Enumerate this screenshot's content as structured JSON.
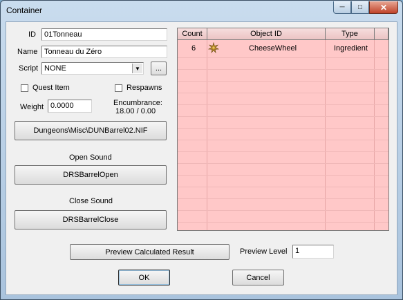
{
  "window": {
    "title": "Container"
  },
  "form": {
    "id_label": "ID",
    "id_value": "01Tonneau",
    "name_label": "Name",
    "name_value": "Tonneau du Zéro",
    "script_label": "Script",
    "script_value": "NONE",
    "browse_label": "...",
    "quest_item_label": "Quest Item",
    "quest_item_checked": false,
    "respawns_label": "Respawns",
    "respawns_checked": false,
    "weight_label": "Weight",
    "weight_value": "0.0000",
    "encumbrance_label": "Encumbrance:",
    "encumbrance_value": "18.00 / 0.00",
    "model_button": "Dungeons\\Misc\\DUNBarrel02.NIF",
    "open_sound_label": "Open Sound",
    "open_sound_button": "DRSBarrelOpen",
    "close_sound_label": "Close Sound",
    "close_sound_button": "DRSBarrelClose"
  },
  "table": {
    "columns": [
      "Count",
      "Object ID",
      "Type"
    ],
    "rows": [
      {
        "count": "6",
        "icon": "cheese-wheel-icon",
        "object_id": "CheeseWheel",
        "type": "Ingredient"
      }
    ]
  },
  "footer": {
    "preview_button": "Preview Calculated Result",
    "preview_level_label": "Preview Level",
    "preview_level_value": "1",
    "ok_button": "OK",
    "cancel_button": "Cancel"
  },
  "colors": {
    "list_bg": "#ffc8c8",
    "titlebar": "#b7cfe6",
    "close_button": "#c0432a"
  }
}
